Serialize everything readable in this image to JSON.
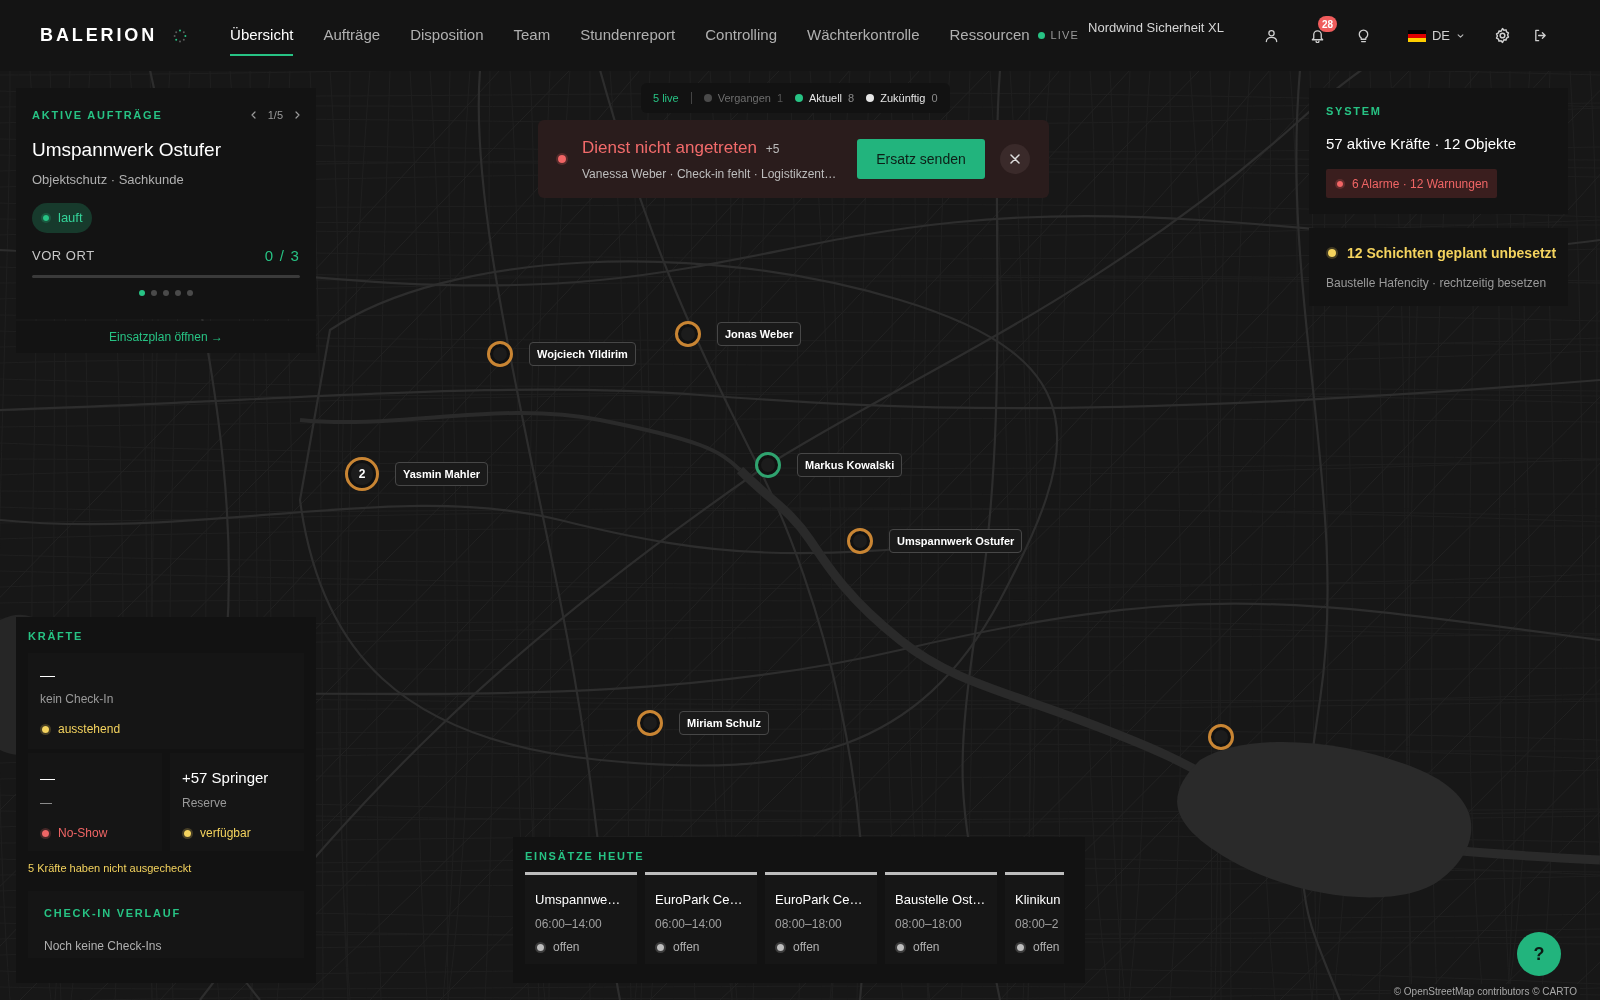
{
  "nav": {
    "logo": "BALERION",
    "items": [
      {
        "label": "Übersicht",
        "selected": true
      },
      {
        "label": "Aufträge",
        "selected": false
      },
      {
        "label": "Disposition",
        "selected": false
      },
      {
        "label": "Team",
        "selected": false
      },
      {
        "label": "Stundenreport",
        "selected": false
      },
      {
        "label": "Controlling",
        "selected": false
      },
      {
        "label": "Wächterkontrolle",
        "selected": false
      },
      {
        "label": "Ressourcen",
        "selected": false
      }
    ],
    "live": {
      "label": "LIVE",
      "on": true
    },
    "organization": "Nordwind Sicherheit XL",
    "notification_count": "28",
    "language": "DE"
  },
  "timeline_filter": {
    "live_count": "5 live",
    "items": [
      {
        "label": "Vergangen",
        "count": "1",
        "color": "#4a4a4a",
        "on": false
      },
      {
        "label": "Aktuell",
        "count": "8",
        "color": "#27c384",
        "on": true
      },
      {
        "label": "Zukünftig",
        "count": "0",
        "color": "#e6e6e6",
        "on": true
      }
    ]
  },
  "alert": {
    "title": "Dienst nicht angetreten",
    "more": "+5",
    "detail": "Vanessa Weber · Check-in fehlt · Logistikzent…",
    "action": "Ersatz senden"
  },
  "active_orders": {
    "heading": "AKTIVE AUFTRÄGE",
    "page": "1/5",
    "title": "Umspannwerk Ostufer",
    "subtitle": "Objektschutz · Sachkunde",
    "status": "lauft",
    "onsite_label": "VOR ORT",
    "onsite_count": "0 / 3",
    "level": 0,
    "pages": [
      {
        "selected": true
      },
      {
        "selected": false
      },
      {
        "selected": false
      },
      {
        "selected": false
      },
      {
        "selected": false
      }
    ],
    "link": "Einsatzplan öffnen →"
  },
  "system": {
    "heading": "SYSTEM",
    "summary": "57 aktive Kräfte · 12 Objekte",
    "alarms": "6 Alarme · 12 Warnungen"
  },
  "notice": {
    "title": "12 Schichten geplant unbesetzt",
    "detail": "Baustelle Hafencity · rechtzeitig besetzen"
  },
  "map": {
    "markers": [
      {
        "label": "Wojciech Yildirim",
        "color": "#c98533"
      },
      {
        "label": "Jonas Weber",
        "color": "#c98533"
      },
      {
        "label": "Yasmin Mahler",
        "count": "2",
        "color": "#c98533"
      },
      {
        "label": "Markus Kowalski",
        "color": "#2fa36f"
      },
      {
        "label": "Umspannwerk Ostufer",
        "color": "#c98533"
      },
      {
        "label": "Miriam Schulz",
        "color": "#c98533"
      },
      {
        "color": "#c98533"
      }
    ],
    "attribution": "© OpenStreetMap contributors © CARTO"
  },
  "forces": {
    "heading": "KRÄFTE",
    "groups": [
      {
        "value": "—",
        "label": "kein Check-In",
        "status": "ausstehend",
        "color": "#f4d35e"
      },
      {
        "value": "—",
        "label": "—",
        "status": "No-Show",
        "color": "#f06565"
      },
      {
        "value": "+57 Springer",
        "label": "Reserve",
        "status": "verfügbar",
        "color": "#f4d35e"
      }
    ],
    "warning": "5 Kräfte haben nicht ausgecheckt",
    "history": {
      "heading": "CHECK-IN VERLAUF",
      "empty": "Noch keine Check-Ins"
    }
  },
  "assignments": {
    "heading": "EINSÄTZE HEUTE",
    "items": [
      {
        "title": "Umspannwe…",
        "time": "06:00–14:00",
        "status": "offen"
      },
      {
        "title": "EuroPark Ce…",
        "time": "06:00–14:00",
        "status": "offen"
      },
      {
        "title": "EuroPark Ce…",
        "time": "08:00–18:00",
        "status": "offen"
      },
      {
        "title": "Baustelle Ost…",
        "time": "08:00–18:00",
        "status": "offen"
      },
      {
        "title": "Klinikun",
        "time": "08:00–2",
        "status": "offen"
      }
    ]
  },
  "help": "?"
}
